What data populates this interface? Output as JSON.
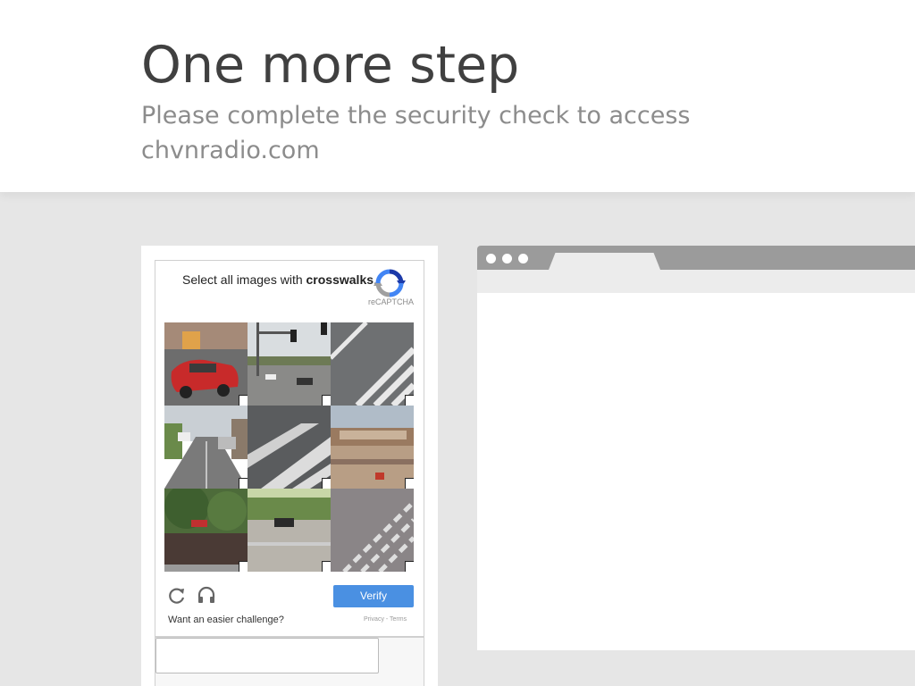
{
  "header": {
    "title": "One more step",
    "subtitle": "Please complete the security check to access chvnradio.com"
  },
  "captcha": {
    "prompt_prefix": "Select all images with",
    "prompt_keyword": "crosswalks",
    "prompt_suffix": ".",
    "logo_text": "reCAPTCHA",
    "verify_label": "Verify",
    "easier_link": "Want an easier challenge?",
    "privacy_terms": "Privacy - Terms",
    "tiles": [
      {
        "name": "red-car-street"
      },
      {
        "name": "intersection-traffic-lights"
      },
      {
        "name": "crosswalk-closeup-1"
      },
      {
        "name": "street-with-cars"
      },
      {
        "name": "crosswalk-closeup-2"
      },
      {
        "name": "bridge-overpass"
      },
      {
        "name": "trees-and-car"
      },
      {
        "name": "road-with-car"
      },
      {
        "name": "crosswalk-closeup-3"
      }
    ],
    "icons": {
      "reload": "reload-icon",
      "audio": "headphones-icon",
      "logo": "recaptcha-logo-icon"
    },
    "accent_color": "#4a90e2"
  }
}
